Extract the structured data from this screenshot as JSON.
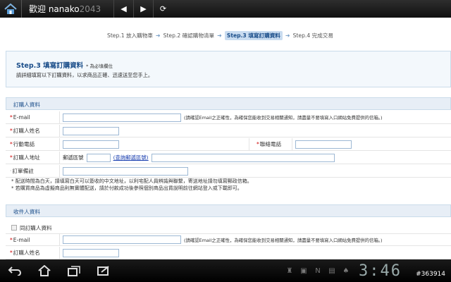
{
  "topbar": {
    "title": "歡迎 nanako",
    "title_blur": "2043",
    "back": "◀",
    "forward": "▶",
    "reload": "⟳"
  },
  "steps": [
    {
      "label": "Step.1 放入購物車",
      "active": false
    },
    {
      "label": "Step.2 確認購物清單",
      "active": false
    },
    {
      "label": "Step.3 填寫訂購資料",
      "active": true
    },
    {
      "label": "Step.4 完成交易",
      "active": false
    }
  ],
  "intro": {
    "title": "Step.3 填寫訂購資料",
    "required_note": "* 為必填欄位",
    "desc": "請詳細填寫以下訂購資料，以求商品正確、迅速送至您手上。"
  },
  "buyer": {
    "section": "訂購人資料",
    "email_label": "E-mail",
    "email_hint": "(請確認Email之正確性，為確保您能收到交易相關通知，請盡量不要填寫入口網站免費提供的信箱。)",
    "name_label": "訂購人姓名",
    "mobile_label": "行動電話",
    "phone_label": "聯絡電話",
    "address_label": "訂購人地址",
    "zip_label": "郵遞區號",
    "zip_link": "(查詢郵遞區號)",
    "memo_label": "訂單備註"
  },
  "notes": [
    "* 配送時間為白天，請填寫白天可以簽收的中文地址，以利宅配人員辨識與聯繫，寄送地址請勿填寫郵政信箱。",
    "* 若購買商品為虛擬商品則無實體配送，請於付款成功後參照個別商品出貨說明前往網站登入或下載即可。"
  ],
  "receiver": {
    "section": "收件人資料",
    "same_label": "同訂購人資料",
    "email_label": "E-mail",
    "email_hint": "(請確認Email之正確性，為確保您能收到交易相關通知，請盡量不要填寫入口網站免費提供的信箱。)",
    "name_label": "訂購人姓名"
  },
  "navbar": {
    "clock": "3:46",
    "watermark": "#363914"
  }
}
